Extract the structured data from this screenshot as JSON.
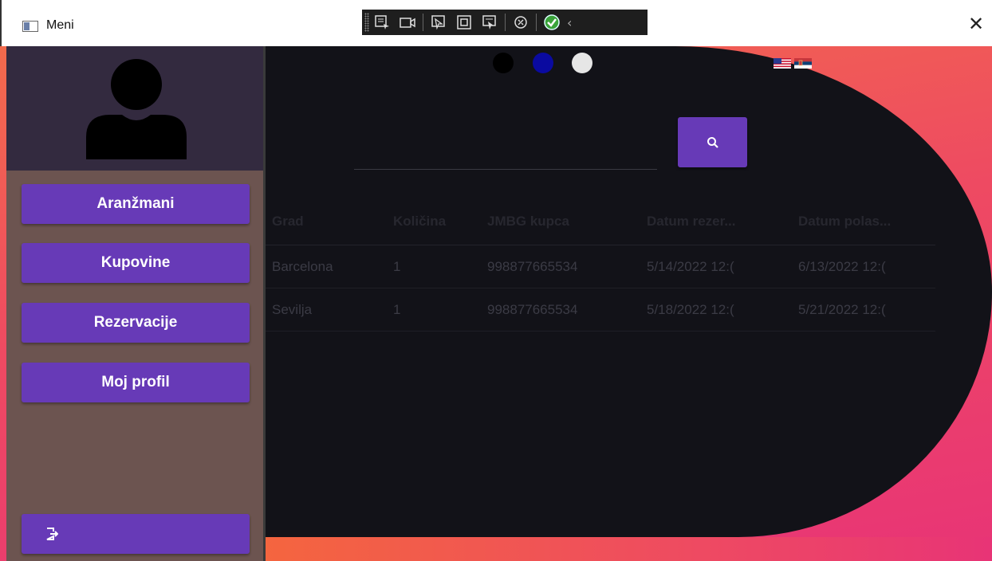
{
  "window": {
    "title": "Meni",
    "close_glyph": "✕"
  },
  "debug_toolbar": {
    "icons": [
      "select-element-icon",
      "record-icon",
      "pointer-icon",
      "layout-adorner-icon",
      "track-focus-icon",
      "hot-reload-icon",
      "check-ok-icon",
      "chevron-left-icon"
    ],
    "chevron": "‹"
  },
  "sidebar": {
    "avatar_icon": "user-silhouette-icon",
    "nav": [
      {
        "label": "Aranžmani"
      },
      {
        "label": "Kupovine"
      },
      {
        "label": "Rezervacije"
      },
      {
        "label": "Moj profil"
      }
    ],
    "logout_icon": "logout-icon",
    "colors": {
      "panel": "#6c5450",
      "avatar_bg": "#332a3f",
      "button": "#673ab7"
    }
  },
  "themes": [
    {
      "name": "dark",
      "color": "#000000"
    },
    {
      "name": "blue",
      "color": "#0a0aa0"
    },
    {
      "name": "light",
      "color": "#e6e6e6"
    }
  ],
  "languages": [
    {
      "code": "en",
      "icon": "us-flag-icon"
    },
    {
      "code": "sr",
      "icon": "serbia-flag-icon"
    }
  ],
  "search": {
    "value": "",
    "placeholder": "",
    "icon": "search-icon"
  },
  "table": {
    "headers": [
      "Grad",
      "Količina",
      "JMBG kupca",
      "Datum rezer...",
      "Datum polas..."
    ],
    "rows": [
      [
        "Barcelona",
        "1",
        "998877665534",
        "5/14/2022 12:(",
        "6/13/2022 12:("
      ],
      [
        "Sevilja",
        "1",
        "998877665534",
        "5/18/2022 12:(",
        "5/21/2022 12:("
      ]
    ]
  }
}
